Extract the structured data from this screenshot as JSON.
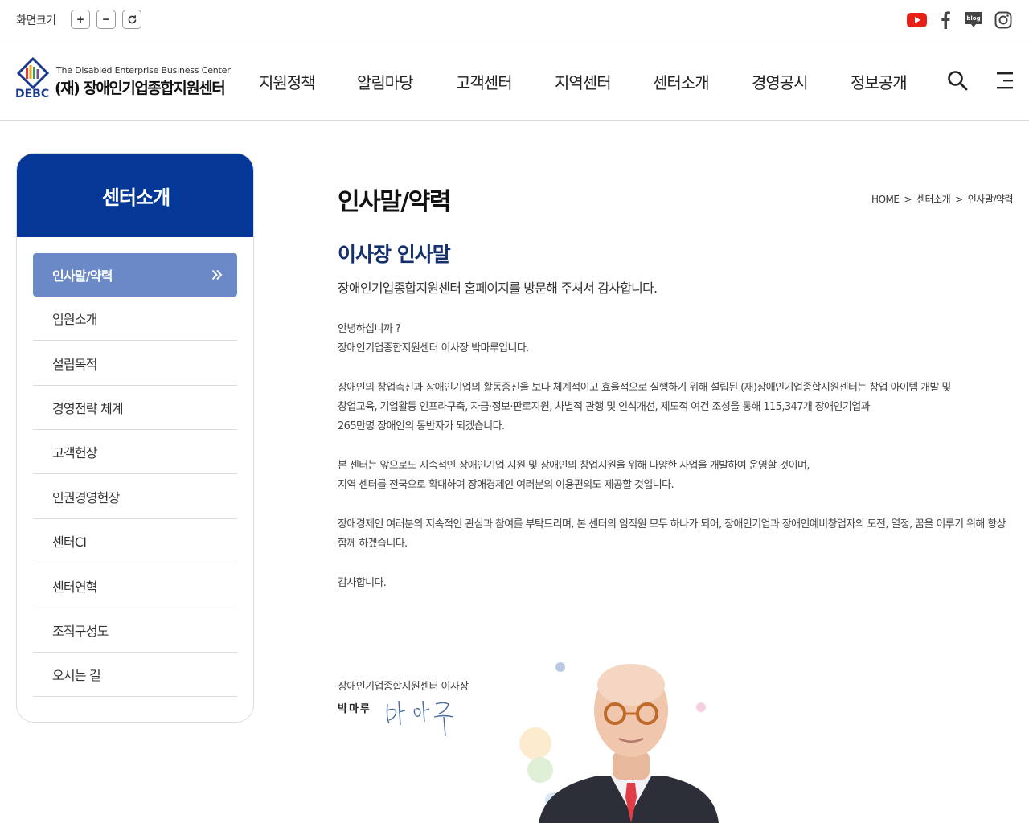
{
  "util": {
    "screen_size_label": "화면크기",
    "zoom_in": "+",
    "zoom_out": "−",
    "reset_icon": "refresh-icon",
    "social": [
      "youtube-icon",
      "facebook-icon",
      "blog-icon",
      "instagram-icon"
    ],
    "blog_text": "blog"
  },
  "header": {
    "logo_en": "The Disabled Enterprise Business Center",
    "logo_ko": "(재) 장애인기업종합지원센터",
    "logo_abbr": "DEBC",
    "nav": [
      "지원정책",
      "알림마당",
      "고객센터",
      "지역센터",
      "센터소개",
      "경영공시",
      "정보공개"
    ],
    "search_icon": "search-icon",
    "menu_icon": "menu-icon"
  },
  "sidebar": {
    "title": "센터소개",
    "active": "인사말/약력",
    "items": [
      "임원소개",
      "설립목적",
      "경영전략 체계",
      "고객헌장",
      "인권경영헌장",
      "센터CI",
      "센터연혁",
      "조직구성도",
      "오시는 길"
    ]
  },
  "main": {
    "page_title": "인사말/약력",
    "breadcrumb": [
      "HOME",
      ">",
      "센터소개",
      ">",
      "인사말/약력"
    ],
    "section_title": "이사장 인사말",
    "lead": "장애인기업종합지원센터 홈페이지를 방문해 주셔서 감사합니다.",
    "paragraphs": [
      [
        "안녕하십니까 ?",
        "장애인기업종합지원센터 이사장 박마루입니다."
      ],
      [
        "장애인의 창업촉진과 장애인기업의 활동증진을 보다 체계적이고 효율적으로 실행하기 위해 설립된 (재)장애인기업종합지원센터는 창업 아이템 개발 및",
        "창업교육, 기업활동 인프라구축, 자금·정보·판로지원, 차별적 관행 및 인식개선, 제도적 여건 조성을 통해 115,347개 장애인기업과",
        "265만명 장애인의 동반자가 되겠습니다."
      ],
      [
        "본 센터는 앞으로도 지속적인 장애인기업 지원 및 장애인의 창업지원을 위해 다양한 사업을 개발하여 운영할 것이며,",
        "지역 센터를 전국으로 확대하여 장애경제인 여러분의 이용편의도 제공할 것입니다."
      ],
      [
        "장애경제인 여러분의 지속적인 관심과 참여를 부탁드리며, 본 센터의 임직원 모두 하나가 되어, 장애인기업과 장애인예비창업자의 도전, 열정, 꿈을 이루기 위해 항상",
        "함께 하겠습니다."
      ],
      [
        "감사합니다."
      ]
    ],
    "sign_org": "장애인기업종합지원센터 이사장",
    "sign_name": "박마루"
  },
  "colors": {
    "brand_navy": "#053796",
    "active_item": "#6a89c6",
    "section_title": "#14306e"
  }
}
